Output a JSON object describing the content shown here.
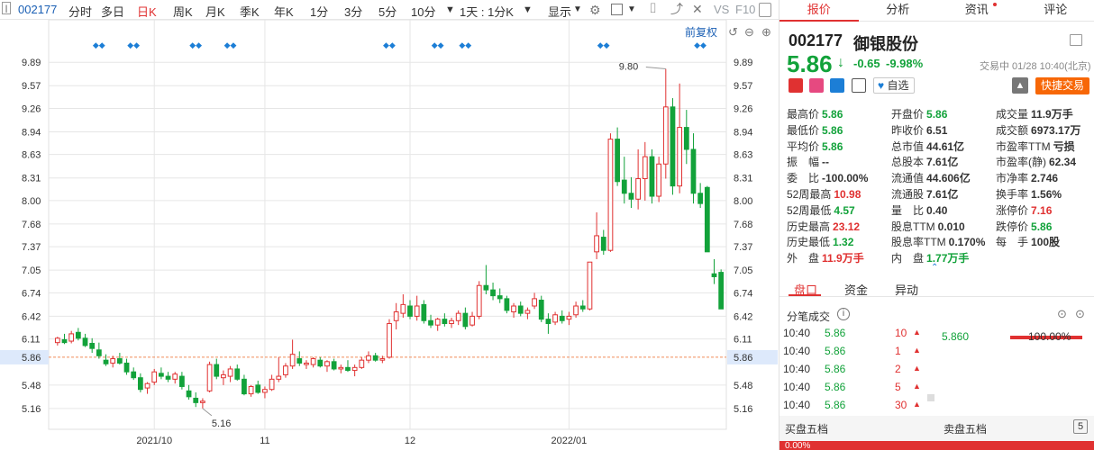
{
  "toolbar": {
    "stock_code": "002177",
    "periods": [
      "分时",
      "多日",
      "日K",
      "周K",
      "月K",
      "季K",
      "年K",
      "1分",
      "3分",
      "5分",
      "10分"
    ],
    "active_period": "日K",
    "range_select": "1天 : 1分K",
    "display_label": "显示",
    "vs_label": "VS",
    "f10_label": "F10"
  },
  "chart": {
    "restore_label": "前复权",
    "y_ticks": [
      "9.89",
      "9.57",
      "9.26",
      "8.94",
      "8.63",
      "8.31",
      "8.00",
      "7.68",
      "7.37",
      "7.05",
      "6.74",
      "6.42",
      "6.11",
      "5.86",
      "5.48",
      "5.16"
    ],
    "x_ticks": [
      "2021/10",
      "11",
      "12",
      "2022/01"
    ],
    "high_annotation": "9.80",
    "low_annotation": "5.16",
    "current_price_marker": "5.86",
    "colors": {
      "up": "#e03131",
      "down": "#12a23a",
      "grid": "#e6e6e6",
      "price_line": "#f08c5a",
      "marker_blue": "#1c7ed6"
    },
    "chart_data": {
      "type": "candlestick",
      "series": [
        {
          "o": 6.06,
          "h": 6.14,
          "l": 6.02,
          "c": 6.12
        },
        {
          "o": 6.1,
          "h": 6.18,
          "l": 6.04,
          "c": 6.06
        },
        {
          "o": 6.08,
          "h": 6.22,
          "l": 6.05,
          "c": 6.18
        },
        {
          "o": 6.2,
          "h": 6.26,
          "l": 6.09,
          "c": 6.12
        },
        {
          "o": 6.12,
          "h": 6.18,
          "l": 6.0,
          "c": 6.02
        },
        {
          "o": 6.05,
          "h": 6.12,
          "l": 5.92,
          "c": 5.98
        },
        {
          "o": 5.96,
          "h": 6.06,
          "l": 5.84,
          "c": 5.88
        },
        {
          "o": 5.82,
          "h": 5.9,
          "l": 5.74,
          "c": 5.77
        },
        {
          "o": 5.78,
          "h": 5.88,
          "l": 5.72,
          "c": 5.84
        },
        {
          "o": 5.84,
          "h": 5.92,
          "l": 5.76,
          "c": 5.78
        },
        {
          "o": 5.78,
          "h": 5.84,
          "l": 5.62,
          "c": 5.66
        },
        {
          "o": 5.66,
          "h": 5.72,
          "l": 5.55,
          "c": 5.58
        },
        {
          "o": 5.58,
          "h": 5.64,
          "l": 5.38,
          "c": 5.42
        },
        {
          "o": 5.44,
          "h": 5.52,
          "l": 5.36,
          "c": 5.5
        },
        {
          "o": 5.52,
          "h": 5.7,
          "l": 5.48,
          "c": 5.66
        },
        {
          "o": 5.64,
          "h": 5.72,
          "l": 5.56,
          "c": 5.6
        },
        {
          "o": 5.6,
          "h": 5.66,
          "l": 5.52,
          "c": 5.56
        },
        {
          "o": 5.56,
          "h": 5.66,
          "l": 5.5,
          "c": 5.63
        },
        {
          "o": 5.6,
          "h": 5.66,
          "l": 5.42,
          "c": 5.46
        },
        {
          "o": 5.4,
          "h": 5.48,
          "l": 5.28,
          "c": 5.32
        },
        {
          "o": 5.3,
          "h": 5.38,
          "l": 5.18,
          "c": 5.24
        },
        {
          "o": 5.24,
          "h": 5.3,
          "l": 5.16,
          "c": 5.26
        },
        {
          "o": 5.4,
          "h": 5.8,
          "l": 5.38,
          "c": 5.76
        },
        {
          "o": 5.76,
          "h": 5.84,
          "l": 5.56,
          "c": 5.6
        },
        {
          "o": 5.58,
          "h": 5.68,
          "l": 5.48,
          "c": 5.62
        },
        {
          "o": 5.6,
          "h": 5.74,
          "l": 5.52,
          "c": 5.7
        },
        {
          "o": 5.7,
          "h": 5.76,
          "l": 5.54,
          "c": 5.56
        },
        {
          "o": 5.56,
          "h": 5.62,
          "l": 5.34,
          "c": 5.36
        },
        {
          "o": 5.36,
          "h": 5.48,
          "l": 5.32,
          "c": 5.46
        },
        {
          "o": 5.48,
          "h": 5.54,
          "l": 5.36,
          "c": 5.38
        },
        {
          "o": 5.38,
          "h": 5.46,
          "l": 5.3,
          "c": 5.42
        },
        {
          "o": 5.42,
          "h": 5.62,
          "l": 5.4,
          "c": 5.56
        },
        {
          "o": 5.56,
          "h": 5.86,
          "l": 5.52,
          "c": 5.6
        },
        {
          "o": 5.62,
          "h": 5.78,
          "l": 5.58,
          "c": 5.74
        },
        {
          "o": 5.74,
          "h": 6.1,
          "l": 5.7,
          "c": 5.9
        },
        {
          "o": 5.84,
          "h": 5.94,
          "l": 5.74,
          "c": 5.78
        },
        {
          "o": 5.76,
          "h": 5.82,
          "l": 5.7,
          "c": 5.78
        },
        {
          "o": 5.76,
          "h": 5.86,
          "l": 5.72,
          "c": 5.84
        },
        {
          "o": 5.82,
          "h": 5.86,
          "l": 5.72,
          "c": 5.74
        },
        {
          "o": 5.74,
          "h": 5.82,
          "l": 5.66,
          "c": 5.8
        },
        {
          "o": 5.8,
          "h": 5.84,
          "l": 5.68,
          "c": 5.7
        },
        {
          "o": 5.7,
          "h": 5.76,
          "l": 5.64,
          "c": 5.72
        },
        {
          "o": 5.72,
          "h": 5.82,
          "l": 5.66,
          "c": 5.68
        },
        {
          "o": 5.68,
          "h": 5.76,
          "l": 5.6,
          "c": 5.72
        },
        {
          "o": 5.72,
          "h": 5.86,
          "l": 5.7,
          "c": 5.82
        },
        {
          "o": 5.82,
          "h": 5.94,
          "l": 5.78,
          "c": 5.88
        },
        {
          "o": 5.88,
          "h": 5.92,
          "l": 5.8,
          "c": 5.82
        },
        {
          "o": 5.82,
          "h": 5.88,
          "l": 5.78,
          "c": 5.84
        },
        {
          "o": 5.86,
          "h": 6.38,
          "l": 5.84,
          "c": 6.32
        },
        {
          "o": 6.36,
          "h": 6.6,
          "l": 6.24,
          "c": 6.48
        },
        {
          "o": 6.46,
          "h": 6.72,
          "l": 6.4,
          "c": 6.58
        },
        {
          "o": 6.56,
          "h": 6.64,
          "l": 6.38,
          "c": 6.42
        },
        {
          "o": 6.42,
          "h": 6.7,
          "l": 6.36,
          "c": 6.56
        },
        {
          "o": 6.58,
          "h": 6.64,
          "l": 6.32,
          "c": 6.36
        },
        {
          "o": 6.36,
          "h": 6.44,
          "l": 6.26,
          "c": 6.3
        },
        {
          "o": 6.3,
          "h": 6.4,
          "l": 6.22,
          "c": 6.38
        },
        {
          "o": 6.38,
          "h": 6.46,
          "l": 6.28,
          "c": 6.32
        },
        {
          "o": 6.32,
          "h": 6.4,
          "l": 6.26,
          "c": 6.36
        },
        {
          "o": 6.36,
          "h": 6.5,
          "l": 6.3,
          "c": 6.46
        },
        {
          "o": 6.46,
          "h": 6.54,
          "l": 6.24,
          "c": 6.28
        },
        {
          "o": 6.3,
          "h": 6.48,
          "l": 6.28,
          "c": 6.42
        },
        {
          "o": 6.42,
          "h": 6.9,
          "l": 6.38,
          "c": 6.84
        },
        {
          "o": 6.84,
          "h": 7.12,
          "l": 6.72,
          "c": 6.78
        },
        {
          "o": 6.78,
          "h": 6.88,
          "l": 6.64,
          "c": 6.7
        },
        {
          "o": 6.7,
          "h": 6.8,
          "l": 6.6,
          "c": 6.66
        },
        {
          "o": 6.66,
          "h": 6.7,
          "l": 6.46,
          "c": 6.5
        },
        {
          "o": 6.48,
          "h": 6.6,
          "l": 6.4,
          "c": 6.56
        },
        {
          "o": 6.56,
          "h": 6.62,
          "l": 6.42,
          "c": 6.46
        },
        {
          "o": 6.46,
          "h": 6.54,
          "l": 6.38,
          "c": 6.5
        },
        {
          "o": 6.56,
          "h": 6.74,
          "l": 6.52,
          "c": 6.66
        },
        {
          "o": 6.64,
          "h": 6.7,
          "l": 6.34,
          "c": 6.38
        },
        {
          "o": 6.38,
          "h": 6.46,
          "l": 6.18,
          "c": 6.32
        },
        {
          "o": 6.34,
          "h": 6.48,
          "l": 6.3,
          "c": 6.44
        },
        {
          "o": 6.42,
          "h": 6.5,
          "l": 6.32,
          "c": 6.36
        },
        {
          "o": 6.38,
          "h": 6.48,
          "l": 6.3,
          "c": 6.42
        },
        {
          "o": 6.44,
          "h": 6.62,
          "l": 6.4,
          "c": 6.56
        },
        {
          "o": 6.56,
          "h": 6.64,
          "l": 6.48,
          "c": 6.52
        },
        {
          "o": 6.52,
          "h": 7.1,
          "l": 6.5,
          "c": 7.16
        },
        {
          "o": 7.3,
          "h": 7.84,
          "l": 7.2,
          "c": 7.52
        },
        {
          "o": 7.5,
          "h": 7.6,
          "l": 7.26,
          "c": 7.32
        },
        {
          "o": 7.32,
          "h": 8.92,
          "l": 7.3,
          "c": 8.84
        },
        {
          "o": 8.84,
          "h": 9.0,
          "l": 8.2,
          "c": 8.26
        },
        {
          "o": 8.28,
          "h": 8.6,
          "l": 7.96,
          "c": 8.1
        },
        {
          "o": 8.1,
          "h": 8.32,
          "l": 7.9,
          "c": 8.02
        },
        {
          "o": 8.02,
          "h": 8.7,
          "l": 7.88,
          "c": 8.3
        },
        {
          "o": 8.3,
          "h": 8.8,
          "l": 8.0,
          "c": 8.6
        },
        {
          "o": 8.6,
          "h": 8.7,
          "l": 7.96,
          "c": 8.06
        },
        {
          "o": 8.06,
          "h": 8.6,
          "l": 7.98,
          "c": 8.5
        },
        {
          "o": 8.5,
          "h": 9.8,
          "l": 8.3,
          "c": 9.28
        },
        {
          "o": 9.28,
          "h": 9.4,
          "l": 8.08,
          "c": 8.2
        },
        {
          "o": 8.2,
          "h": 9.6,
          "l": 8.1,
          "c": 9.0
        },
        {
          "o": 9.0,
          "h": 9.24,
          "l": 8.5,
          "c": 8.7
        },
        {
          "o": 8.7,
          "h": 8.92,
          "l": 7.96,
          "c": 8.1
        },
        {
          "o": 8.1,
          "h": 8.24,
          "l": 7.9,
          "c": 7.96
        },
        {
          "o": 8.18,
          "h": 8.2,
          "l": 7.3,
          "c": 7.3
        },
        {
          "o": 7.0,
          "h": 7.2,
          "l": 6.86,
          "c": 6.96
        },
        {
          "o": 7.02,
          "h": 7.06,
          "l": 6.52,
          "c": 6.52
        }
      ],
      "ylim": [
        4.9,
        10.2
      ]
    }
  },
  "right": {
    "tabs": [
      "报价",
      "分析",
      "资讯",
      "评论"
    ],
    "active_tab": "报价",
    "stock_code": "002177",
    "stock_name": "御银股份",
    "price": "5.86",
    "change": "-0.65",
    "change_pct": "-9.98%",
    "trade_time": "交易中 01/28 10:40(北京)",
    "self_select": "自选",
    "quick_trade": "快捷交易",
    "quote_rows": [
      [
        {
          "label": "最高价",
          "value": "5.86",
          "cls": "green"
        },
        {
          "label": "开盘价",
          "value": "5.86",
          "cls": "green"
        },
        {
          "label": "成交量",
          "value": "11.9万手",
          "cls": ""
        }
      ],
      [
        {
          "label": "最低价",
          "value": "5.86",
          "cls": "green"
        },
        {
          "label": "昨收价",
          "value": "6.51",
          "cls": ""
        },
        {
          "label": "成交额",
          "value": "6973.17万",
          "cls": ""
        }
      ],
      [
        {
          "label": "平均价",
          "value": "5.86",
          "cls": "green"
        },
        {
          "label": "总市值",
          "value": "44.61亿",
          "cls": ""
        },
        {
          "label": "市盈率TTM",
          "value": "亏损",
          "cls": ""
        }
      ],
      [
        {
          "label": "振　幅",
          "value": "--",
          "cls": ""
        },
        {
          "label": "总股本",
          "value": "7.61亿",
          "cls": ""
        },
        {
          "label": "市盈率(静)",
          "value": "62.34",
          "cls": ""
        }
      ],
      [
        {
          "label": "委　比",
          "value": "-100.00%",
          "cls": ""
        },
        {
          "label": "流通值",
          "value": "44.606亿",
          "cls": ""
        },
        {
          "label": "市净率",
          "value": "2.746",
          "cls": ""
        }
      ],
      [
        {
          "label": "52周最高",
          "value": "10.98",
          "cls": "red"
        },
        {
          "label": "流通股",
          "value": "7.61亿",
          "cls": ""
        },
        {
          "label": "换手率",
          "value": "1.56%",
          "cls": ""
        }
      ],
      [
        {
          "label": "52周最低",
          "value": "4.57",
          "cls": "green"
        },
        {
          "label": "量　比",
          "value": "0.40",
          "cls": ""
        },
        {
          "label": "涨停价",
          "value": "7.16",
          "cls": "red"
        }
      ],
      [
        {
          "label": "历史最高",
          "value": "23.12",
          "cls": "red"
        },
        {
          "label": "股息TTM",
          "value": "0.010",
          "cls": ""
        },
        {
          "label": "跌停价",
          "value": "5.86",
          "cls": "green"
        }
      ],
      [
        {
          "label": "历史最低",
          "value": "1.32",
          "cls": "green"
        },
        {
          "label": "股息率TTM",
          "value": "0.170%",
          "cls": ""
        },
        {
          "label": "每　手",
          "value": "100股",
          "cls": ""
        }
      ],
      [
        {
          "label": "外　盘",
          "value": "11.9万手",
          "cls": "red"
        },
        {
          "label": "内　盘",
          "value": "1.77万手",
          "cls": "green"
        },
        {
          "label": "",
          "value": "",
          "cls": ""
        }
      ]
    ],
    "sub_tabs": [
      "盘口",
      "资金",
      "异动"
    ],
    "active_sub_tab": "盘口",
    "ticks_title": "分笔成交",
    "ticks": [
      {
        "time": "10:40",
        "price": "5.86",
        "vol": "10"
      },
      {
        "time": "10:40",
        "price": "5.86",
        "vol": "1"
      },
      {
        "time": "10:40",
        "price": "5.86",
        "vol": "2"
      },
      {
        "time": "10:40",
        "price": "5.86",
        "vol": "5"
      },
      {
        "time": "10:40",
        "price": "5.86",
        "vol": "30"
      }
    ],
    "depth_price": "5.860",
    "depth_pct": "100.00%",
    "buy_five": "买盘五档",
    "sell_five": "卖盘五档",
    "bottom_pct": "0.00%"
  }
}
